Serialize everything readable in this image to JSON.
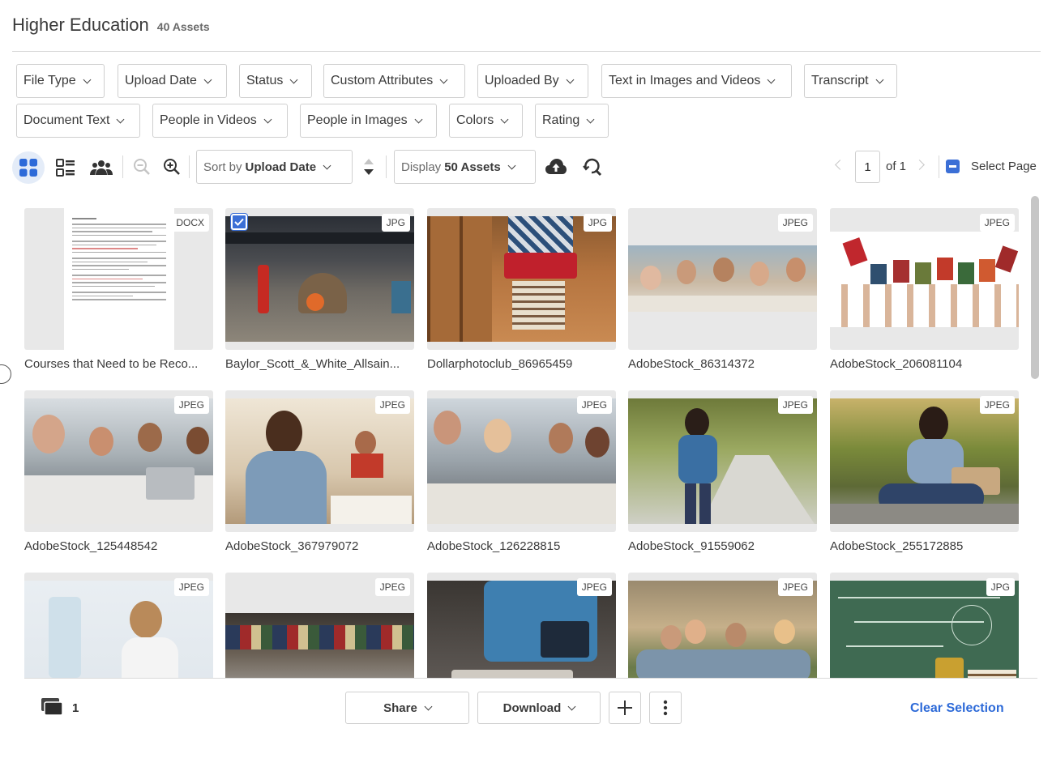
{
  "header": {
    "title": "Higher Education",
    "asset_count": "40 Assets"
  },
  "filters": {
    "row1": [
      "File Type",
      "Upload Date",
      "Status",
      "Custom Attributes",
      "Uploaded By",
      "Text in Images and Videos",
      "Transcript"
    ],
    "row2": [
      "Document Text",
      "People in Videos",
      "People in Images",
      "Colors",
      "Rating"
    ]
  },
  "toolbar": {
    "sort_prefix": "Sort by",
    "sort_value": "Upload Date",
    "display_prefix": "Display",
    "display_value": "50 Assets"
  },
  "pager": {
    "current_page": "1",
    "of_label": "of 1",
    "select_page_label": "Select Page"
  },
  "assets": [
    {
      "name": "Courses that Need to be Reco...",
      "type": "DOCX",
      "selected": false
    },
    {
      "name": "Baylor_Scott_&_White_Allsain...",
      "type": "JPG",
      "selected": true
    },
    {
      "name": "Dollarphotoclub_86965459",
      "type": "JPG",
      "selected": false
    },
    {
      "name": "AdobeStock_86314372",
      "type": "JPEG",
      "selected": false
    },
    {
      "name": "AdobeStock_206081104",
      "type": "JPEG",
      "selected": false
    },
    {
      "name": "AdobeStock_125448542",
      "type": "JPEG",
      "selected": false
    },
    {
      "name": "AdobeStock_367979072",
      "type": "JPEG",
      "selected": false
    },
    {
      "name": "AdobeStock_126228815",
      "type": "JPEG",
      "selected": false
    },
    {
      "name": "AdobeStock_91559062",
      "type": "JPEG",
      "selected": false
    },
    {
      "name": "AdobeStock_255172885",
      "type": "JPEG",
      "selected": false
    },
    {
      "name": "",
      "type": "JPEG",
      "selected": false
    },
    {
      "name": "",
      "type": "JPEG",
      "selected": false
    },
    {
      "name": "",
      "type": "JPEG",
      "selected": false
    },
    {
      "name": "",
      "type": "JPEG",
      "selected": false
    },
    {
      "name": "",
      "type": "JPG",
      "selected": false
    }
  ],
  "bottom_bar": {
    "selected_count": "1",
    "share_label": "Share",
    "download_label": "Download",
    "clear_selection_label": "Clear Selection"
  }
}
